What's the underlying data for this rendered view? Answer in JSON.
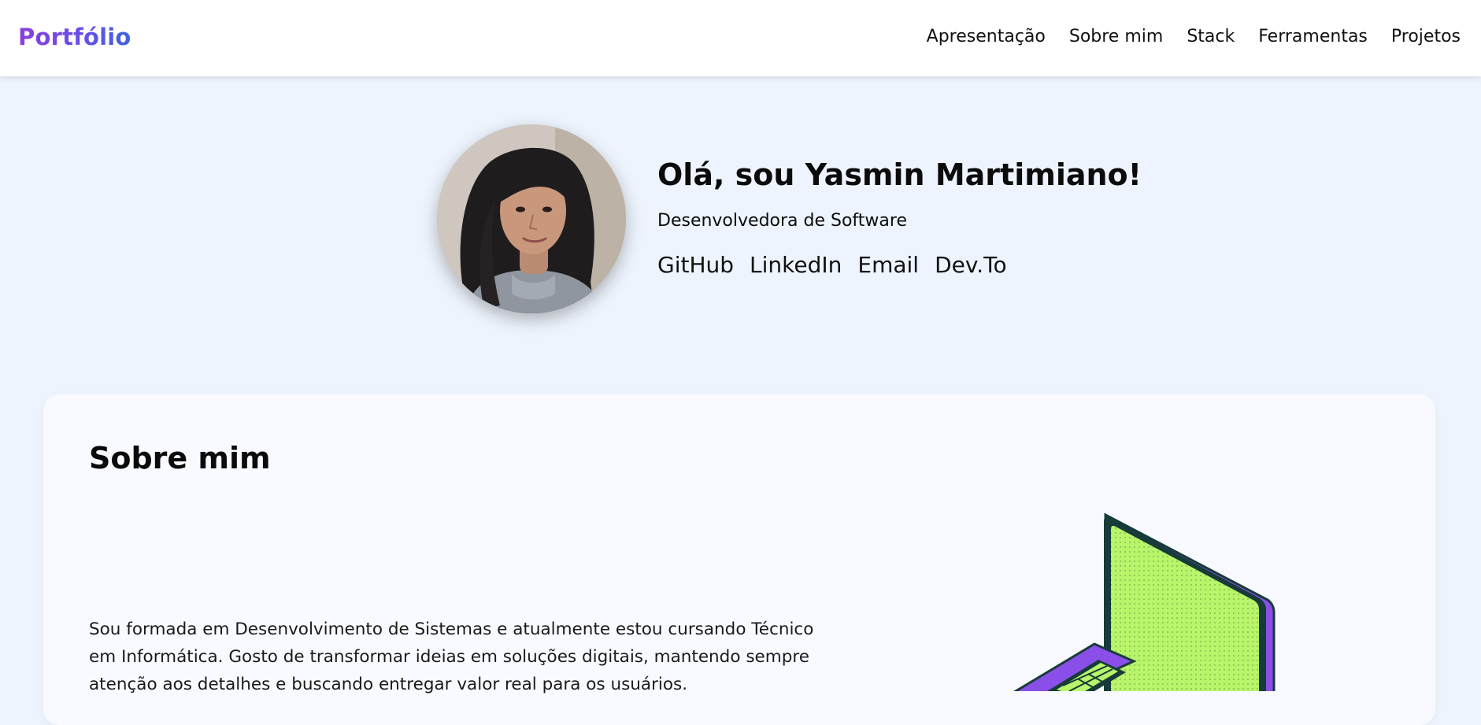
{
  "header": {
    "brand": "Portfólio",
    "nav": [
      "Apresentação",
      "Sobre mim",
      "Stack",
      "Ferramentas",
      "Projetos"
    ]
  },
  "hero": {
    "title": "Olá, sou Yasmin Martimiano!",
    "subtitle": "Desenvolvedora de Software",
    "links": [
      "GitHub",
      "LinkedIn",
      "Email",
      "Dev.To"
    ]
  },
  "about": {
    "title": "Sobre mim",
    "text": "Sou formada em Desenvolvimento de Sistemas e atualmente estou cursando Técnico em Informática. Gosto de transformar ideias em soluções digitais, mantendo sempre atenção aos detalhes e buscando entregar valor real para os usuários."
  },
  "colors": {
    "brand_start": "#8a3fe0",
    "brand_end": "#3f63e0",
    "page_background": "#eef4fd",
    "card_background": "#f8faff",
    "laptop_screen": "#b8f56a",
    "laptop_body": "#8a4fe8",
    "laptop_outline": "#173b38"
  },
  "icons": {
    "avatar": "profile-photo",
    "illustration": "laptop-illustration"
  }
}
